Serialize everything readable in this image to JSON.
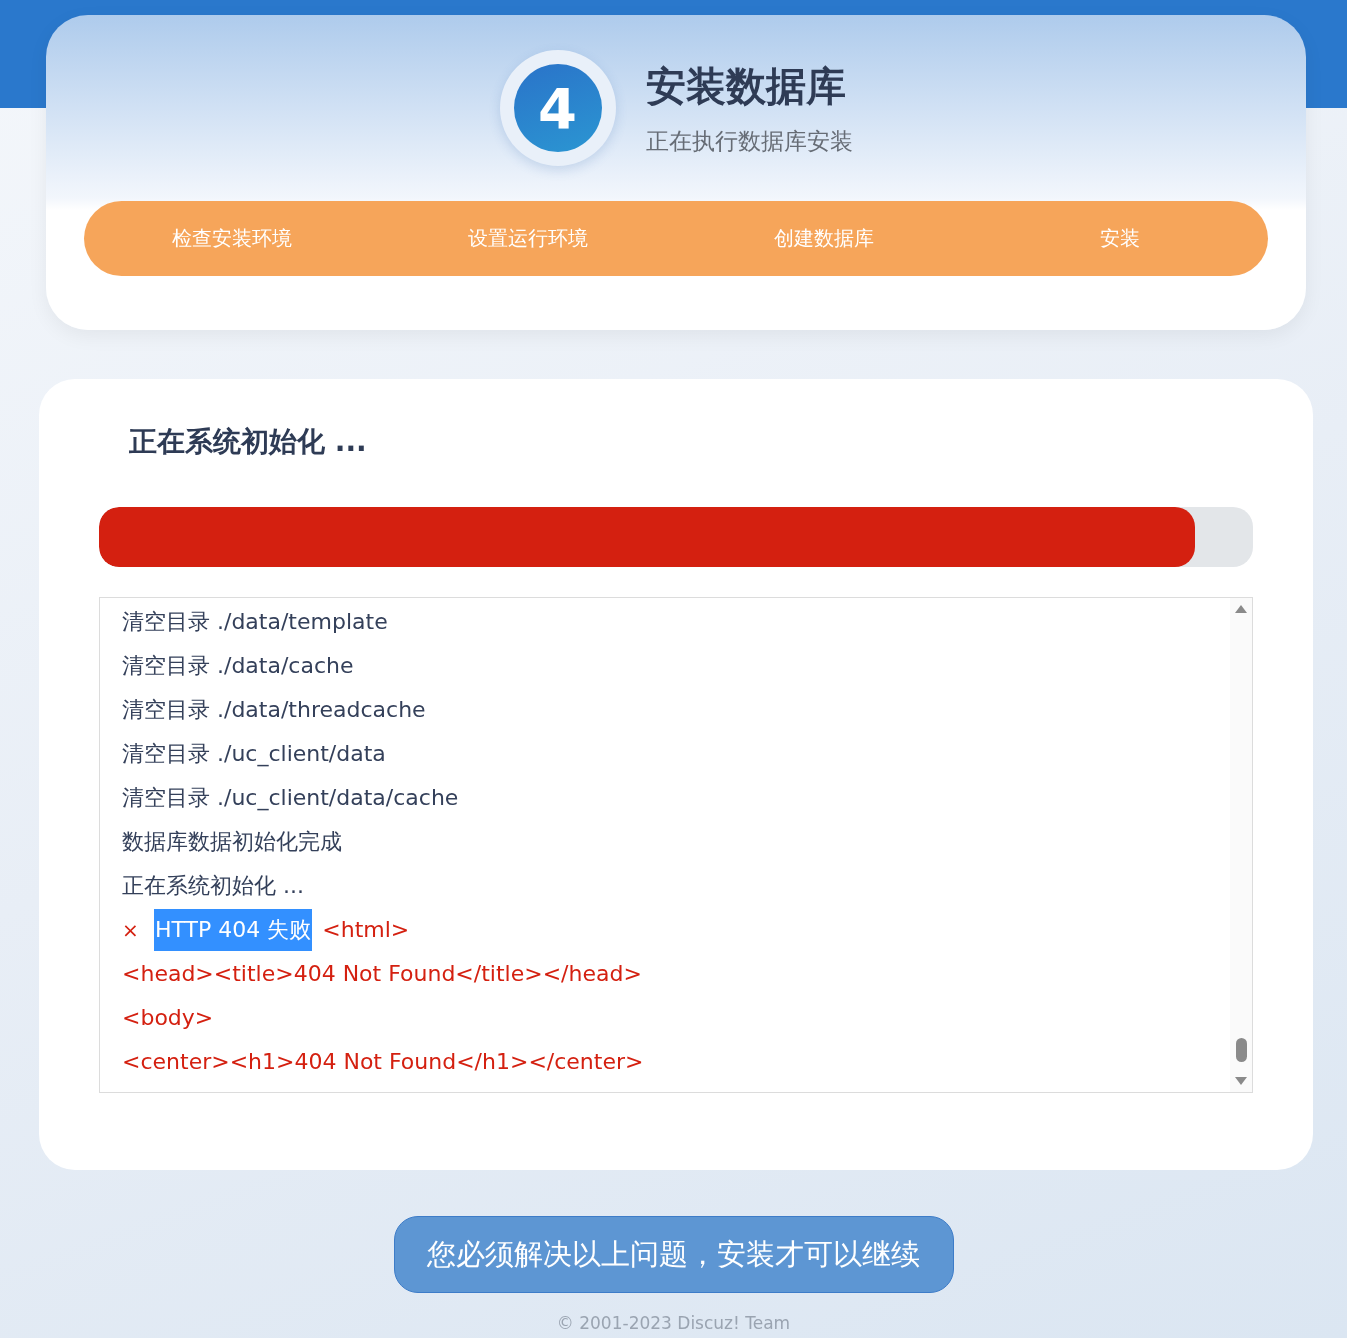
{
  "header": {
    "step_number": "4",
    "title": "安装数据库",
    "subtitle": "正在执行数据库安装"
  },
  "steps": [
    "检查安装环境",
    "设置运行环境",
    "创建数据库",
    "安装"
  ],
  "main": {
    "heading": "正在系统初始化 ...",
    "progress": {
      "level": 0.95
    },
    "log": [
      {
        "kind": "normal",
        "text": "清空目录 ./data/template"
      },
      {
        "kind": "normal",
        "text": "清空目录 ./data/cache"
      },
      {
        "kind": "normal",
        "text": "清空目录 ./data/threadcache"
      },
      {
        "kind": "normal",
        "text": "清空目录 ./uc_client/data"
      },
      {
        "kind": "normal",
        "text": "清空目录 ./uc_client/data/cache"
      },
      {
        "kind": "normal",
        "text": "数据库数据初始化完成"
      },
      {
        "kind": "normal",
        "text": "正在系统初始化 ..."
      },
      {
        "kind": "error",
        "icon": "×",
        "text": "HTTP 404 失败",
        "selected": true,
        "detail": "<html>"
      },
      {
        "kind": "code",
        "text": "<head><title>404 Not Found</title></head>"
      },
      {
        "kind": "code",
        "text": "<body>"
      },
      {
        "kind": "code",
        "text": "<center><h1>404 Not Found</h1></center>"
      }
    ]
  },
  "notice_button": "您必须解决以上问题，安装才可以继续",
  "footer": "© 2001-2023 Discuz! Team"
}
